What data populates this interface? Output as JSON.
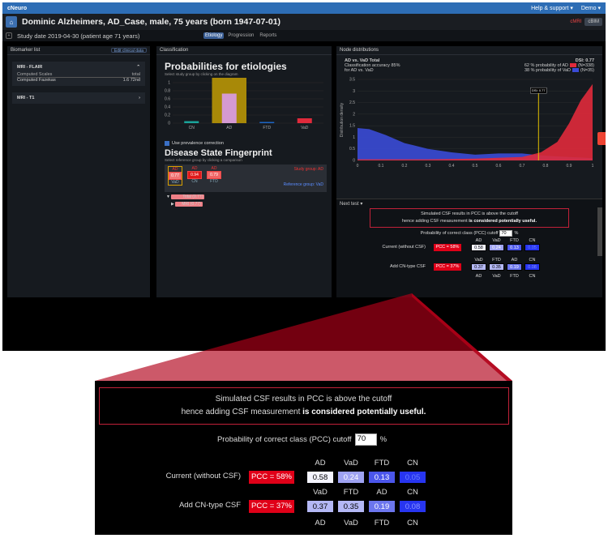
{
  "topbar": {
    "brand": "cNeuro",
    "help": "Help & support ▾",
    "demo": "Demo ▾"
  },
  "header": {
    "patient": "Dominic Alzheimers, AD_Case, male, 75 years (born 1947-07-01)",
    "cmri": "cMRI",
    "cbtn": "cBIM"
  },
  "subheader": {
    "study": "Study date 2019-04-30 (patient age 71 years)",
    "tabs": [
      "Etiology",
      "Progression",
      "Reports"
    ]
  },
  "left": {
    "title": "Biomarker list",
    "edit": "Edit clinical data",
    "section": "MRI - FLAIR",
    "col1": "Computed Scales",
    "col2": "total",
    "item": "Computed Fazekas",
    "itemval": "1.6 72nd",
    "section2": "MRI - T1"
  },
  "middle": {
    "title": "Classification",
    "heading": "Probabilities for etiologies",
    "hint": "Select study group by clicking on the diagram",
    "prev": "Use prevalence correction",
    "fp_heading": "Disease State Fingerprint",
    "fp_hint": "Select reference group by clicking a comparison",
    "study_group": "Study group: AD",
    "ref_group": "Reference group: VaD",
    "boxes": [
      {
        "ab": "AD",
        "val": "0.77",
        "nm": "VaD"
      },
      {
        "ab": "AD",
        "val": "0.94",
        "nm": "CN"
      },
      {
        "ab": "AD",
        "val": "0.79",
        "nm": "FTD"
      }
    ],
    "tree1": "Total (0.77)",
    "tree2": "MRI (0.77)"
  },
  "chart_data": [
    {
      "type": "bar",
      "categories": [
        "CN",
        "AD",
        "FTD",
        "VaD"
      ],
      "values": [
        0.05,
        0.73,
        0.03,
        0.12
      ],
      "ylim": [
        0,
        1
      ],
      "colors": [
        "#1aa39a",
        "#d59ad2",
        "#1d66c6",
        "#e02a3b"
      ],
      "highlight": "AD"
    },
    {
      "type": "area",
      "title": "AD vs. VaD Total",
      "dsi": "DSI: 0.77",
      "xlabel": "",
      "ylabel": "Distribution density",
      "xlim": [
        0,
        1
      ],
      "ylim": [
        0,
        3.5
      ],
      "marker": 0.77,
      "marker_label": "DSI: 0.77",
      "series": [
        {
          "name": "AD",
          "color": "#e02a3b"
        },
        {
          "name": "VaD",
          "color": "#3a4bd6"
        }
      ]
    }
  ],
  "right": {
    "title": "Node distributions",
    "acc": "Classification accuracy 85%",
    "for": "for AD vs. VaD",
    "p1": "62 % probability of AD",
    "p2": "38 % probability of VaD",
    "n1": "(N=338)",
    "n2": "(N=35)",
    "ticksx": [
      "0",
      "0.1",
      "0.2",
      "0.3",
      "0.4",
      "0.5",
      "0.6",
      "0.7",
      "0.8",
      "0.9",
      "1"
    ],
    "ticksy": [
      "0",
      "0.5",
      "1",
      "1.5",
      "2",
      "2.5",
      "3",
      "3.5"
    ],
    "nexttest": "Next test ▾"
  },
  "result": {
    "line1": "Simulated CSF results in PCC is above the cutoff",
    "line2a": "hence adding CSF measurement ",
    "line2b": "is considered potentially useful.",
    "pcc_label": "Probability of correct class (PCC) cutoff",
    "pcc_value": "70",
    "pcc_unit": "%",
    "row1_label": "Current (without CSF)",
    "row1_badge": "PCC = 58%",
    "row1_heads": [
      "AD",
      "VaD",
      "FTD",
      "CN"
    ],
    "row1_vals": [
      "0.58",
      "0.24",
      "0.13",
      "0.05"
    ],
    "row2_label": "Add CN-type CSF",
    "row2_badge": "PCC = 37%",
    "row2_heads": [
      "VaD",
      "FTD",
      "AD",
      "CN"
    ],
    "row2_vals": [
      "0.37",
      "0.35",
      "0.19",
      "0.08"
    ],
    "bottom_heads": [
      "AD",
      "VaD",
      "FTD",
      "CN"
    ]
  },
  "colors": {
    "c1": "#f4f4ff",
    "c2": "#9fa3f2",
    "c3": "#4b56eb",
    "c4": "#2735f0",
    "c2b": "#b4b8f5",
    "c3b": "#6c76ee"
  }
}
